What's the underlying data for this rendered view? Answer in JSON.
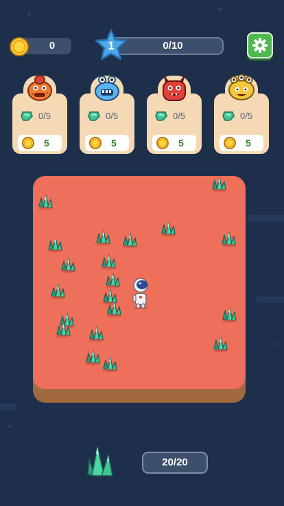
{
  "hud": {
    "coins": "0",
    "level": "1",
    "progress": "0/10",
    "icons": {
      "coin": "gold-coin-icon",
      "level": "blue-star-icon",
      "settings": "gear-icon"
    },
    "colors": {
      "panel": "#3c4f6b",
      "settings": "#4db84d",
      "star": "#4aa8e8"
    }
  },
  "customers": [
    {
      "monster": "orange-monster",
      "color": "#f07a2e",
      "need": "0/5",
      "reward": "5"
    },
    {
      "monster": "blue-monster",
      "color": "#5ab4f0",
      "need": "0/5",
      "reward": "5"
    },
    {
      "monster": "red-monster",
      "color": "#e2403a",
      "need": "0/5",
      "reward": "5"
    },
    {
      "monster": "yellow-monster",
      "color": "#f2c83a",
      "need": "0/5",
      "reward": "5"
    }
  ],
  "board": {
    "ground_color": "#ee705a",
    "crystal_color": "#3ec78e",
    "player": "astronaut"
  },
  "inventory": {
    "icon": "green-crystal-icon",
    "capacity": "20/20"
  }
}
